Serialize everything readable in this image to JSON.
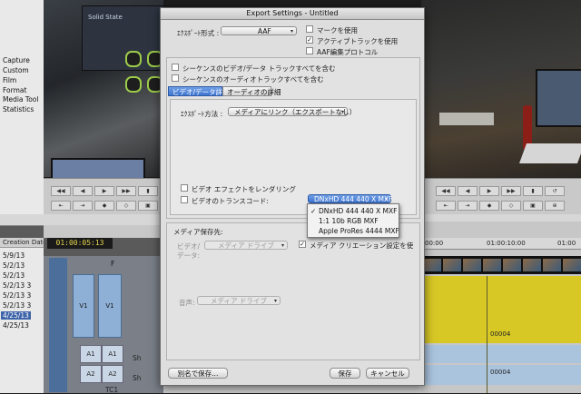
{
  "bin_list": [
    "Capture",
    "Custom",
    "Film",
    "Format",
    "Media Tool",
    "Statistics"
  ],
  "timecode": "01:00:05:13",
  "creation_header": "Creation Date",
  "creation_dates": [
    "5/9/13",
    "5/2/13",
    "5/2/13",
    "5/2/13 3",
    "5/2/13 3",
    "5/2/13 3",
    "4/25/13",
    "4/25/13"
  ],
  "tracks": {
    "v1a": "V1",
    "v1b": "V1",
    "a1a": "A1",
    "a1b": "A1",
    "a2a": "A2",
    "a2b": "A2",
    "f": "F",
    "sh1": "Sh",
    "sh2": "Sh",
    "tc1": "TC1"
  },
  "photo_text": "Solid State",
  "ruler": {
    "t1": "00:00",
    "t2": "01:00:10:00",
    "t3": "01:00"
  },
  "clip_labels": {
    "c1": "00004",
    "c2": "00004"
  },
  "dialog": {
    "title": "Export Settings - Untitled",
    "export_format_label": "ｴｸｽﾎﾟｰﾄ形式 :",
    "export_format_value": "AAF",
    "use_marks": "マークを使用",
    "use_active_tracks": "アクティブトラックを使用",
    "aaf_edit_protocol": "AAF編集プロトコル",
    "include_all_video": "シーケンスのビデオ/データ トラックすべてを含む",
    "include_all_audio": "シーケンスのオーディオトラックすべてを含む",
    "tab_video": "ビデオ/データ詳細",
    "tab_audio": "オーディオの詳細",
    "export_method_label": "ｴｸｽﾎﾟｰﾄ方法 :",
    "export_method_value": "メディアにリンク（エクスポートなし）",
    "render_effects": "ビデオ エフェクトをレンダリング",
    "transcode_video": "ビデオのトランスコード:",
    "codec_value": "DNxHD 444 440 X  MXF",
    "media_dest_label": "メディア保存先:",
    "video_data_label": "ビデオ/",
    "video_data_label2": "データ:",
    "media_drive": "メディア ドライブ",
    "use_media_creation": "メディア クリエーション設定を使",
    "audio_label": "音声:",
    "audio_drive": "メディア ドライブ",
    "save_as": "別名で保存...",
    "save": "保存",
    "cancel": "キャンセル"
  },
  "codec_options": [
    "DNxHD 444 440 X  MXF",
    "1:1 10b RGB  MXF",
    "Apple ProRes 4444  MXF"
  ],
  "checked_mark": "✓"
}
